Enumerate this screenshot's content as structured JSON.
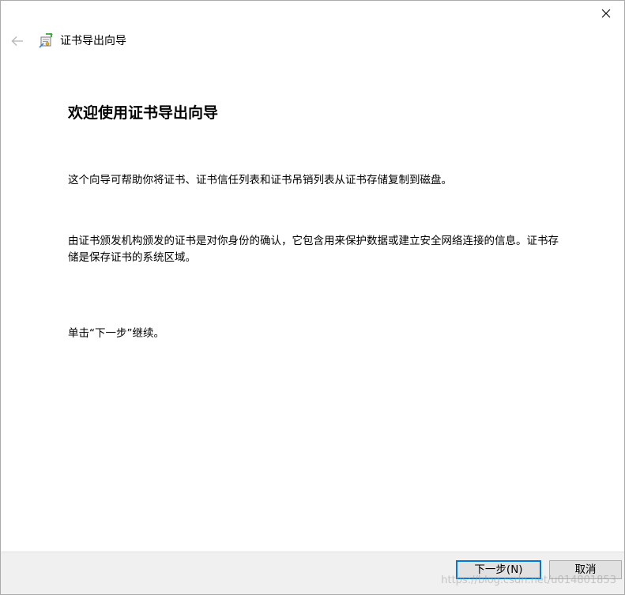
{
  "window": {
    "close_icon": "close-icon"
  },
  "header": {
    "back_icon": "back-arrow-icon",
    "wizard_icon": "certificate-export-icon",
    "title": "证书导出向导"
  },
  "main": {
    "heading": "欢迎使用证书导出向导",
    "paragraph_1": "这个向导可帮助你将证书、证书信任列表和证书吊销列表从证书存储复制到磁盘。",
    "paragraph_2": "由证书颁发机构颁发的证书是对你身份的确认，它包含用来保护数据或建立安全网络连接的信息。证书存储是保存证书的系统区域。",
    "paragraph_3": "单击“下一步”继续。"
  },
  "footer": {
    "next_label": "下一步(N)",
    "cancel_label": "取消"
  },
  "watermark": {
    "text": "https://blog.csdn.net/u014801853"
  },
  "colors": {
    "accent": "#0078d7",
    "footer_bg": "#f0f0f0",
    "button_bg": "#e1e1e1"
  }
}
